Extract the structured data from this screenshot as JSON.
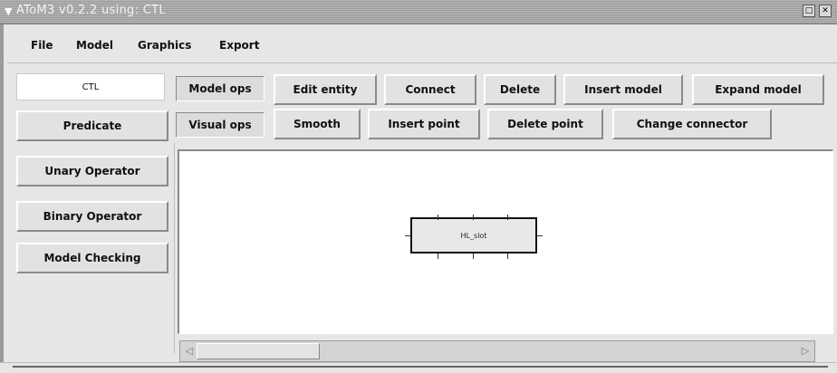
{
  "window": {
    "title": "AToM3 v0.2.2 using: CTL",
    "menu_icon": "chevron-down-icon",
    "maximize_glyph": "□",
    "close_glyph": "✕"
  },
  "menubar": {
    "items": [
      {
        "label": "File"
      },
      {
        "label": "Model"
      },
      {
        "label": "Graphics"
      },
      {
        "label": "Export"
      }
    ]
  },
  "formalism_field": {
    "value": "CTL"
  },
  "left_buttons": [
    {
      "label": "Predicate"
    },
    {
      "label": "Unary Operator"
    },
    {
      "label": "Binary Operator"
    },
    {
      "label": "Model Checking"
    }
  ],
  "model_ops": {
    "section_label": "Model ops",
    "buttons": [
      {
        "label": "Edit entity"
      },
      {
        "label": "Connect"
      },
      {
        "label": "Delete"
      },
      {
        "label": "Insert model"
      },
      {
        "label": "Expand model"
      }
    ]
  },
  "visual_ops": {
    "section_label": "Visual ops",
    "buttons": [
      {
        "label": "Smooth"
      },
      {
        "label": "Insert point"
      },
      {
        "label": "Delete point"
      },
      {
        "label": "Change connector"
      }
    ]
  },
  "canvas": {
    "entity_label": "HL_slot"
  },
  "scrollbar": {
    "left_glyph": "◁",
    "right_glyph": "▷"
  }
}
